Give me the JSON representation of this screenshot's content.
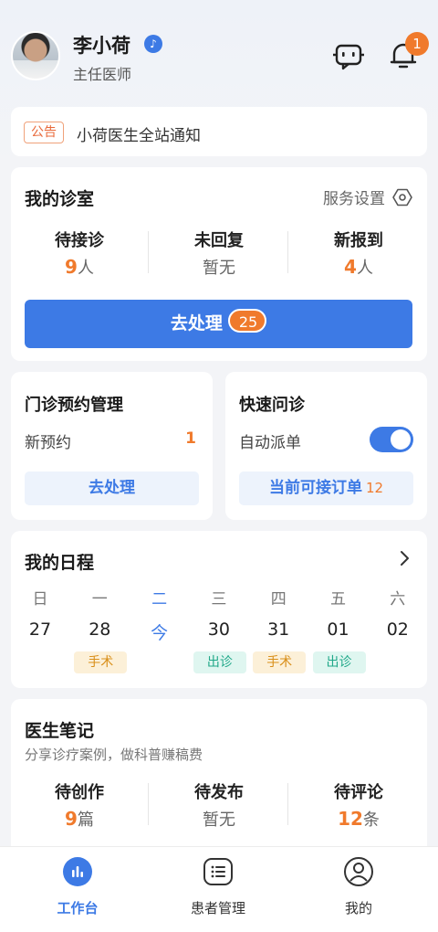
{
  "header": {
    "name": "李小荷",
    "verified_badge": "♪",
    "title": "主任医师",
    "notification_count": "1"
  },
  "notice": {
    "tag": "公告",
    "text": "小荷医生全站通知"
  },
  "clinic": {
    "title": "我的诊室",
    "service_settings": "服务设置",
    "stats": [
      {
        "label": "待接诊",
        "num": "9",
        "unit": "人",
        "none": ""
      },
      {
        "label": "未回复",
        "num": "",
        "unit": "",
        "none": "暂无"
      },
      {
        "label": "新报到",
        "num": "4",
        "unit": "人",
        "none": ""
      }
    ],
    "action_label": "去处理",
    "action_count": "25"
  },
  "outpatient": {
    "title": "门诊预约管理",
    "row_label": "新预约",
    "row_count": "1",
    "button": "去处理"
  },
  "quick": {
    "title": "快速问诊",
    "row_label": "自动派单",
    "toggle_on": true,
    "button": "当前可接订单",
    "button_count": "12"
  },
  "schedule": {
    "title": "我的日程",
    "days": [
      {
        "weekday": "日",
        "date": "27",
        "tag": "",
        "tag_type": ""
      },
      {
        "weekday": "一",
        "date": "28",
        "tag": "手术",
        "tag_type": "surgery"
      },
      {
        "weekday": "二",
        "date": "今",
        "tag": "",
        "tag_type": "",
        "today": true
      },
      {
        "weekday": "三",
        "date": "30",
        "tag": "出诊",
        "tag_type": "clinic"
      },
      {
        "weekday": "四",
        "date": "31",
        "tag": "手术",
        "tag_type": "surgery"
      },
      {
        "weekday": "五",
        "date": "01",
        "tag": "出诊",
        "tag_type": "clinic"
      },
      {
        "weekday": "六",
        "date": "02",
        "tag": "",
        "tag_type": ""
      }
    ]
  },
  "notes": {
    "title": "医生笔记",
    "subtitle": "分享诊疗案例，做科普赚稿费",
    "stats": [
      {
        "label": "待创作",
        "num": "9",
        "unit": "篇",
        "none": ""
      },
      {
        "label": "待发布",
        "num": "",
        "unit": "",
        "none": "暂无"
      },
      {
        "label": "待评论",
        "num": "12",
        "unit": "条",
        "none": ""
      }
    ]
  },
  "tabbar": {
    "tabs": [
      {
        "label": "工作台",
        "icon": "workbench-icon",
        "active": true
      },
      {
        "label": "患者管理",
        "icon": "patient-list-icon",
        "active": false
      },
      {
        "label": "我的",
        "icon": "profile-icon",
        "active": false
      }
    ]
  },
  "colors": {
    "accent": "#3d7ae5",
    "highlight": "#f07a2c"
  }
}
